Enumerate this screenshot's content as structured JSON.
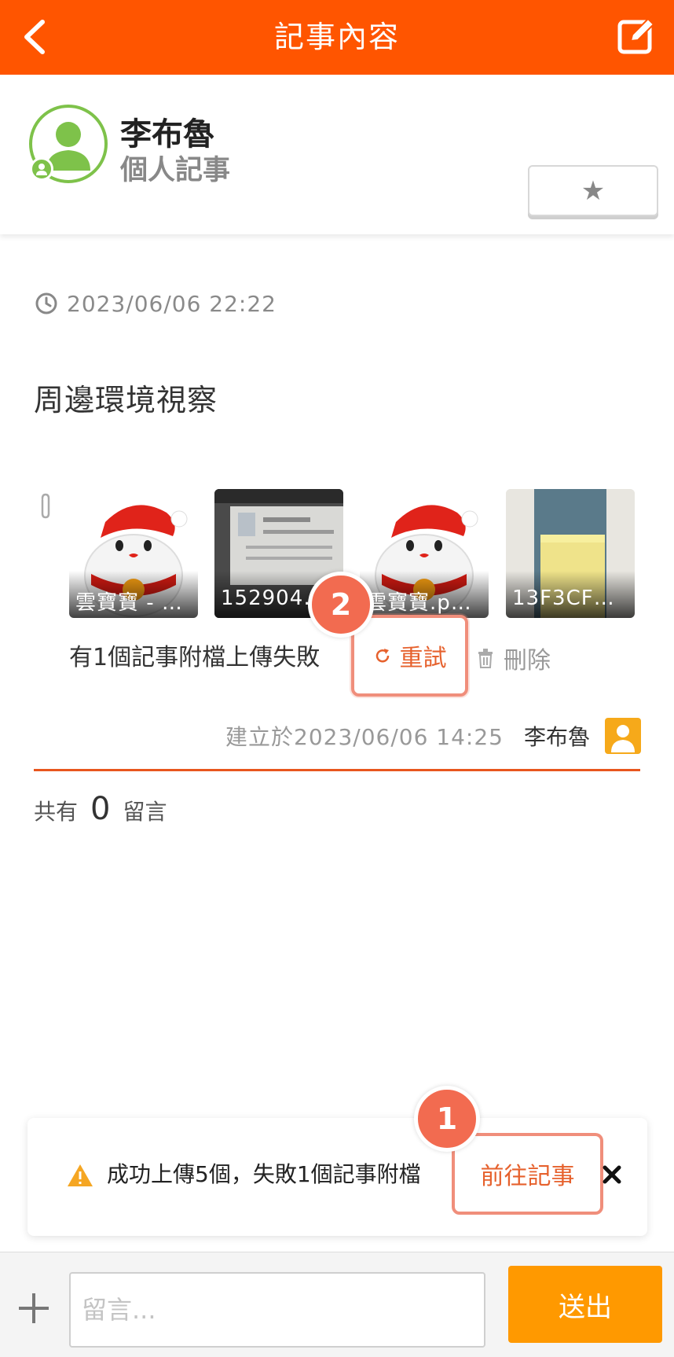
{
  "header": {
    "title": "記事內容",
    "back_icon": "chevron-left-icon",
    "edit_icon": "edit-icon"
  },
  "author": {
    "name": "李布魯",
    "subtitle": "個人記事",
    "star_label": "★"
  },
  "note": {
    "timestamp": "2023/06/06 22:22",
    "title": "周邊環境視察",
    "attachments": [
      {
        "caption": "雲寶寶 - …"
      },
      {
        "caption": "152904…"
      },
      {
        "caption": "雲寶寶.p…"
      },
      {
        "caption": "13F3CF…"
      }
    ],
    "fail_message": "有1個記事附檔上傳失敗",
    "retry_label": "重試",
    "delete_label": "刪除",
    "created_text": "建立於2023/06/06 14:25",
    "creator": "李布魯"
  },
  "comments": {
    "prefix": "共有",
    "count": "0",
    "suffix": "留言"
  },
  "toast": {
    "message": "成功上傳5個，失敗1個記事附檔",
    "action_label": "前往記事",
    "close_icon": "close-icon"
  },
  "annotations": {
    "badge_1": "1",
    "badge_2": "2"
  },
  "composer": {
    "placeholder": "留言...",
    "send_label": "送出"
  },
  "colors": {
    "brand": "#ff5500",
    "send": "#ff9900",
    "highlight": "#f08e7b"
  }
}
